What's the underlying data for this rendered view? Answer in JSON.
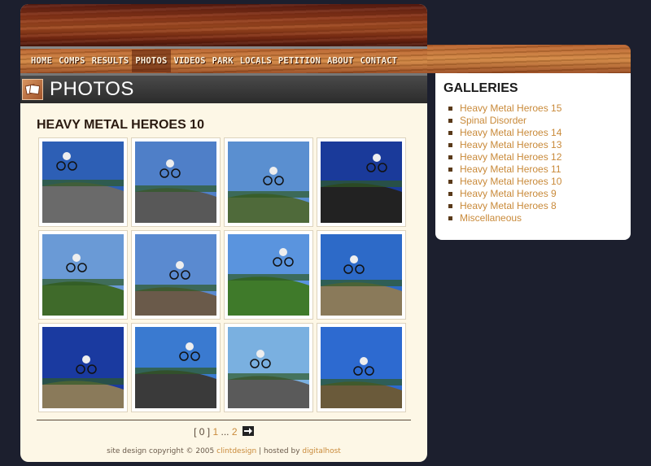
{
  "nav": {
    "items": [
      "HOME",
      "COMPS",
      "RESULTS",
      "PHOTOS",
      "VIDEOS",
      "PARK",
      "LOCALS",
      "PETITION",
      "ABOUT",
      "CONTACT"
    ],
    "active": "PHOTOS"
  },
  "page": {
    "title": "PHOTOS"
  },
  "gallery": {
    "heading": "HEAVY METAL HEROES 10",
    "thumbnails": [
      {
        "sky": "#2d5fb5",
        "ground": "#6a6a6a"
      },
      {
        "sky": "#4f7fc8",
        "ground": "#585858"
      },
      {
        "sky": "#5a8fd0",
        "ground": "#4f6a3a"
      },
      {
        "sky": "#1a3a9a",
        "ground": "#222222"
      },
      {
        "sky": "#6a9ad6",
        "ground": "#3f6a2a"
      },
      {
        "sky": "#5a8ad0",
        "ground": "#6a5a4a"
      },
      {
        "sky": "#5a94de",
        "ground": "#3f7a2a"
      },
      {
        "sky": "#2d6ac8",
        "ground": "#8a7a5a"
      },
      {
        "sky": "#1a3aa0",
        "ground": "#8a7a5a"
      },
      {
        "sky": "#3a7ad0",
        "ground": "#3a3a3a"
      },
      {
        "sky": "#7ab0e0",
        "ground": "#5a5a5a"
      },
      {
        "sky": "#2d6ad0",
        "ground": "#6a5a3a"
      }
    ]
  },
  "pager": {
    "open": "[",
    "current": "0",
    "close": "]",
    "page1": "1",
    "ellipsis": "...",
    "page2": "2"
  },
  "footer": {
    "prefix": "site design copyright © 2005",
    "designer": "clintdesign",
    "sep": "| hosted by",
    "host": "digitalhost"
  },
  "sidebar": {
    "title": "GALLERIES",
    "items": [
      "Heavy Metal Heroes 15",
      "Spinal Disorder",
      "Heavy Metal Heroes 14",
      "Heavy Metal Heroes 13",
      "Heavy Metal Heroes 12",
      "Heavy Metal Heroes 11",
      "Heavy Metal Heroes 10",
      "Heavy Metal Heroes 9",
      "Heavy Metal Heroes 8",
      "Miscellaneous"
    ]
  },
  "colors": {
    "background": "#1c1f2e",
    "link": "#c98a3a",
    "content_bg": "#fdf7e6"
  }
}
